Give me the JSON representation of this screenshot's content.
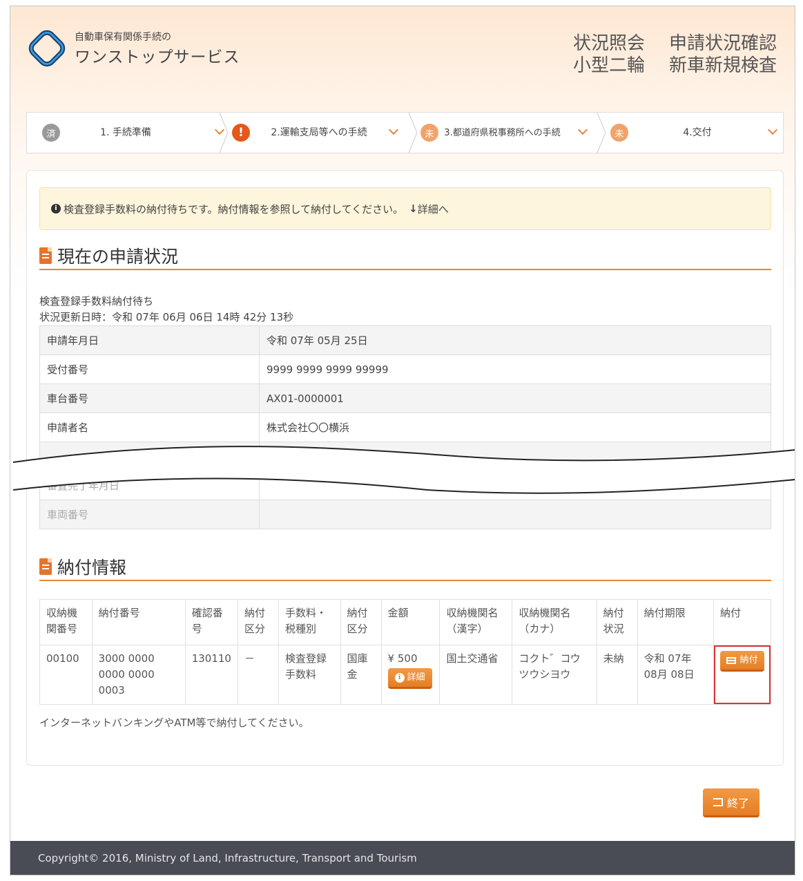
{
  "header": {
    "service_sub": "自動車保有関係手続の",
    "service_main": "ワンストップサービス",
    "title_left_1": "状況照会",
    "title_left_2": "小型二輪",
    "title_right_1": "申請状況確認",
    "title_right_2": "新車新規検査"
  },
  "steps": [
    {
      "icon": "済",
      "label": "1. 手続準備",
      "state": "done"
    },
    {
      "icon": "!",
      "label": "2.運輸支局等への手続",
      "state": "warning"
    },
    {
      "icon": "未",
      "label": "3.都道府県税事務所への手続",
      "state": "todo"
    },
    {
      "icon": "未",
      "label": "4.交付",
      "state": "todo"
    }
  ],
  "alert": {
    "message": "検査登録手数料の納付待ちです。納付情報を参照して納付してください。",
    "link": "詳細へ"
  },
  "status_section": {
    "title": "現在の申請状況",
    "status": "検査登録手数料納付待ち",
    "updated": "状況更新日時：令和 07年 06月 06日 14時 42分 13秒",
    "rows": [
      {
        "key": "申請年月日",
        "value": "令和 07年 05月 25日"
      },
      {
        "key": "受付番号",
        "value": "9999 9999 9999 99999"
      },
      {
        "key": "車台番号",
        "value": "AX01-0000001"
      },
      {
        "key": "申請者名",
        "value": "株式会社〇〇横浜"
      }
    ],
    "faded_rows": [
      {
        "key": "審査完了年月日",
        "value": ""
      },
      {
        "key": "車両番号",
        "value": ""
      }
    ]
  },
  "payment_section": {
    "title": "納付情報",
    "headers": [
      "収納機関番号",
      "納付番号",
      "確認番号",
      "納付区分",
      "手数料・税種別",
      "納付区分",
      "金額",
      "収納機関名（漢字）",
      "収納機関名（カナ）",
      "納付状況",
      "納付期限",
      "納付"
    ],
    "row": {
      "agency_no": "00100",
      "payment_no": "3000 0000 0000 0000 0003",
      "confirm_no": "130110",
      "pay_division": "－",
      "fee_type": "検査登録手数料",
      "pay_class": "国庫金",
      "amount": "¥ 500",
      "detail_btn": "詳細",
      "agency_kanji": "国土交通省",
      "agency_kana": "コクト゛コウツウシヨウ",
      "status": "未納",
      "deadline": "令和 07年 08月 08日",
      "pay_btn": "納付"
    },
    "note": "インターネットバンキングやATM等で納付してください。"
  },
  "end_button": "終了",
  "footer": "Copyright© 2016, Ministry of Land, Infrastructure, Transport and Tourism",
  "colors": {
    "accent": "#e57e24",
    "warning": "#e5571a",
    "footer_bg": "#494b55",
    "highlight": "#dd3333"
  }
}
